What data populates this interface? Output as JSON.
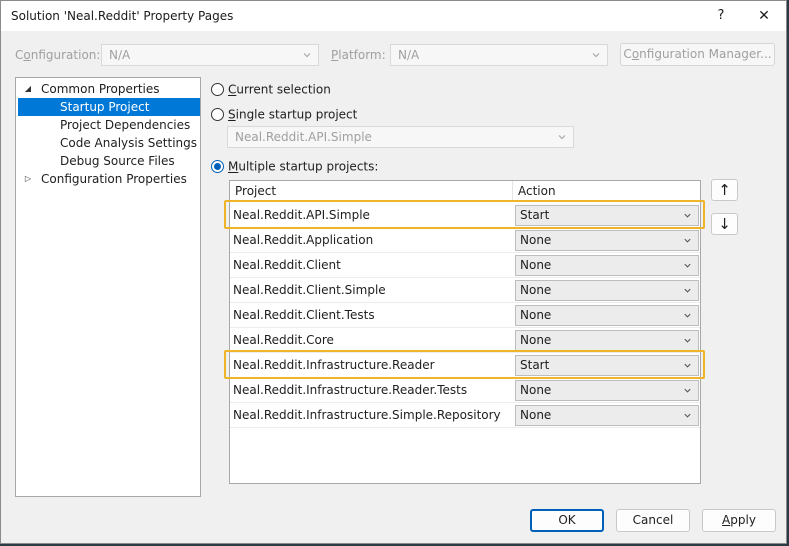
{
  "window": {
    "title": "Solution 'Neal.Reddit' Property Pages",
    "help_glyph": "?",
    "close_glyph": "✕"
  },
  "toolbar": {
    "configuration_label_pre": "C",
    "configuration_label_hot": "o",
    "configuration_label_post": "nfiguration:",
    "configuration_value": "N/A",
    "platform_label_hot": "P",
    "platform_label_post": "latform:",
    "platform_value": "N/A",
    "configuration_manager_pre": "C",
    "configuration_manager_hot": "o",
    "configuration_manager_post": "nfiguration Manager..."
  },
  "tree": {
    "common": {
      "label": "Common Properties",
      "expander": "◢"
    },
    "children": [
      {
        "label": "Startup Project",
        "selected": true
      },
      {
        "label": "Project Dependencies"
      },
      {
        "label": "Code Analysis Settings"
      },
      {
        "label": "Debug Source Files"
      }
    ],
    "config": {
      "label": "Configuration Properties",
      "expander": "▷"
    }
  },
  "startup": {
    "current_hot": "C",
    "current_rest": "urrent selection",
    "single_hot": "S",
    "single_rest": "ingle startup project",
    "single_value": "Neal.Reddit.API.Simple",
    "multiple_hot": "M",
    "multiple_rest": "ultiple startup projects:"
  },
  "grid": {
    "col_project": "Project",
    "col_action": "Action",
    "rows": [
      {
        "project": "Neal.Reddit.API.Simple",
        "action": "Start"
      },
      {
        "project": "Neal.Reddit.Application",
        "action": "None"
      },
      {
        "project": "Neal.Reddit.Client",
        "action": "None"
      },
      {
        "project": "Neal.Reddit.Client.Simple",
        "action": "None"
      },
      {
        "project": "Neal.Reddit.Client.Tests",
        "action": "None"
      },
      {
        "project": "Neal.Reddit.Core",
        "action": "None"
      },
      {
        "project": "Neal.Reddit.Infrastructure.Reader",
        "action": "Start"
      },
      {
        "project": "Neal.Reddit.Infrastructure.Reader.Tests",
        "action": "None"
      },
      {
        "project": "Neal.Reddit.Infrastructure.Simple.Repository",
        "action": "None"
      }
    ]
  },
  "move": {
    "up_glyph": "↑",
    "down_glyph": "↓"
  },
  "buttons": {
    "ok": "OK",
    "cancel": "Cancel",
    "apply_hot": "A",
    "apply_rest": "pply"
  },
  "colors": {
    "highlight": "#f0b429",
    "selection": "#0078d7",
    "radio": "#005fb8"
  }
}
